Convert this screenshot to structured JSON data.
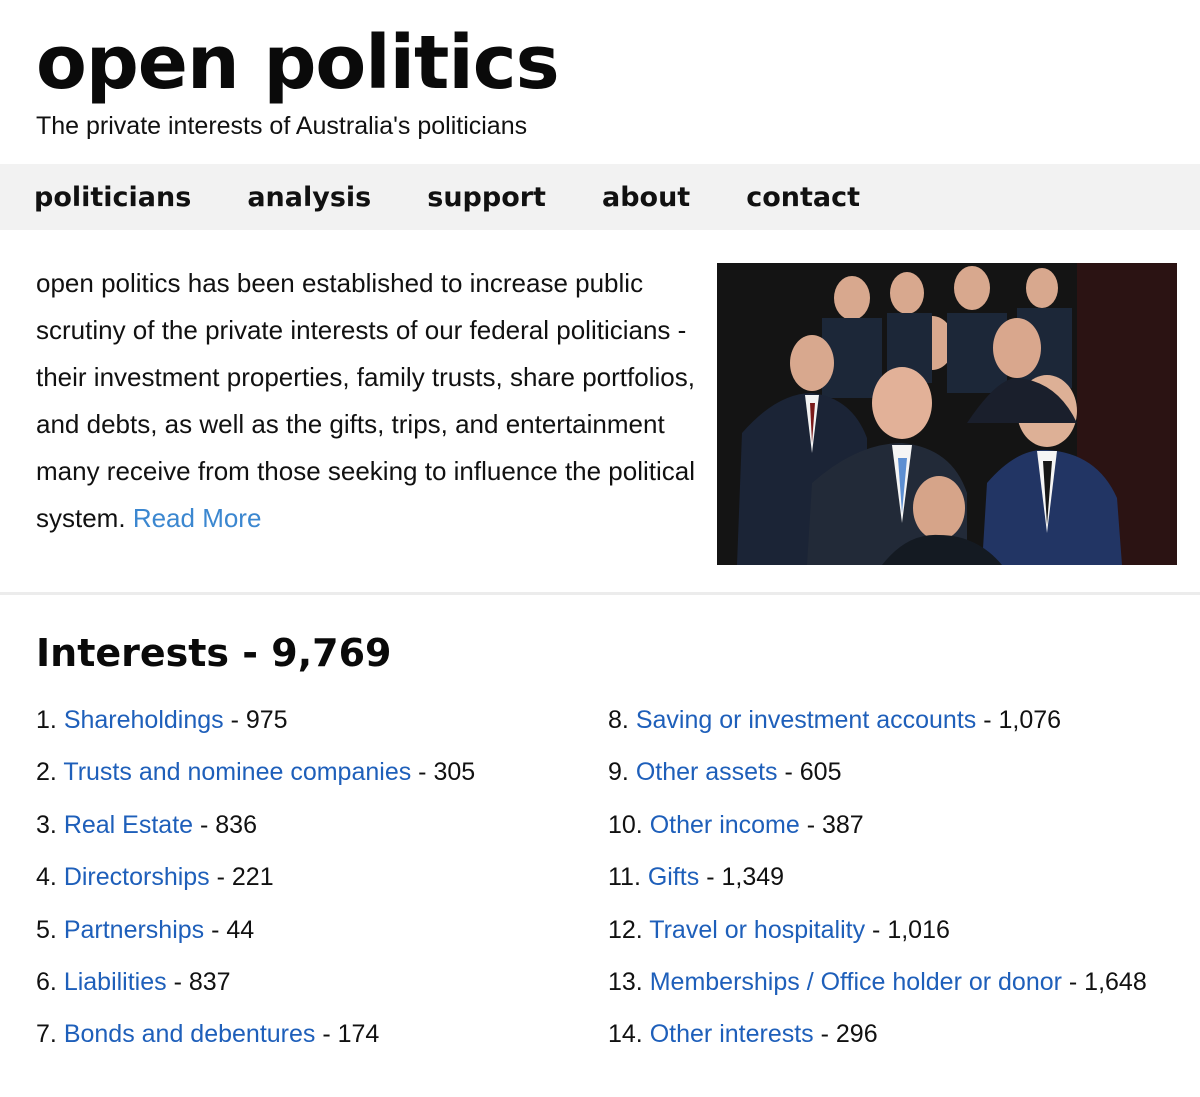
{
  "site": {
    "title": "open politics",
    "tagline": "The private interests of Australia's politicians"
  },
  "nav": [
    {
      "label": "politicians"
    },
    {
      "label": "analysis"
    },
    {
      "label": "support"
    },
    {
      "label": "about"
    },
    {
      "label": "contact"
    }
  ],
  "intro": {
    "text": "open politics has been established to increase public scrutiny of the private interests of our federal politicians - their investment properties, family trusts, share portfolios, and debts, as well as the gifts, trips, and entertainment many receive from those seeking to influence the political system.",
    "read_more": "Read More"
  },
  "interests": {
    "title": "Interests - 9,769",
    "items": [
      {
        "num": "1.",
        "label": "Shareholdings",
        "count": "975"
      },
      {
        "num": "2.",
        "label": "Trusts and nominee companies",
        "count": "305"
      },
      {
        "num": "3.",
        "label": "Real Estate",
        "count": "836"
      },
      {
        "num": "4.",
        "label": "Directorships",
        "count": "221"
      },
      {
        "num": "5.",
        "label": "Partnerships",
        "count": "44"
      },
      {
        "num": "6.",
        "label": "Liabilities",
        "count": "837"
      },
      {
        "num": "7.",
        "label": "Bonds and debentures",
        "count": "174"
      },
      {
        "num": "8.",
        "label": "Saving or investment accounts",
        "count": "1,076"
      },
      {
        "num": "9.",
        "label": "Other assets",
        "count": "605"
      },
      {
        "num": "10.",
        "label": "Other income",
        "count": "387"
      },
      {
        "num": "11.",
        "label": "Gifts",
        "count": "1,349"
      },
      {
        "num": "12.",
        "label": "Travel or hospitality",
        "count": "1,016"
      },
      {
        "num": "13.",
        "label": "Memberships / Office holder or donor",
        "count": "1,648"
      },
      {
        "num": "14.",
        "label": "Other interests",
        "count": "296"
      }
    ]
  },
  "colors": {
    "link": "#1e5fba",
    "read_more": "#3b87d0",
    "nav_bg": "#f2f2f2"
  }
}
